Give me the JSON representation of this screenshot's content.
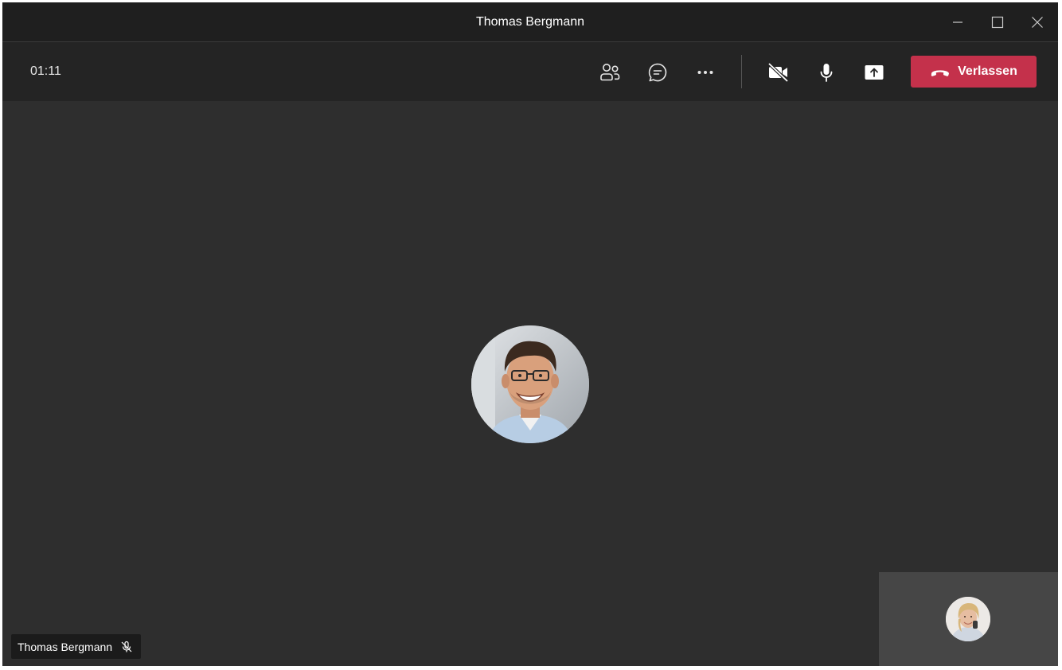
{
  "window": {
    "title": "Thomas Bergmann",
    "controls": {
      "minimize_icon": "minimize-icon",
      "maximize_icon": "maximize-icon",
      "close_icon": "close-icon"
    }
  },
  "toolbar": {
    "timer": "01:11",
    "buttons": [
      {
        "name": "participants",
        "icon": "people-icon"
      },
      {
        "name": "chat",
        "icon": "chat-icon"
      },
      {
        "name": "more",
        "icon": "more-icon"
      },
      {
        "name": "camera",
        "icon": "camera-off-icon"
      },
      {
        "name": "microphone",
        "icon": "microphone-icon"
      },
      {
        "name": "share",
        "icon": "share-screen-icon"
      }
    ],
    "leave_label": "Verlassen",
    "leave_color": "#c4314b"
  },
  "stage": {
    "participant_name": "Thomas Bergmann",
    "participant_muted": true,
    "self_view": {
      "avatar": "self-avatar"
    }
  },
  "colors": {
    "titlebar": "#1f1f1f",
    "toolbar": "#242424",
    "stage": "#2e2e2e",
    "self_view": "#464646",
    "accent_leave": "#c4314b"
  }
}
